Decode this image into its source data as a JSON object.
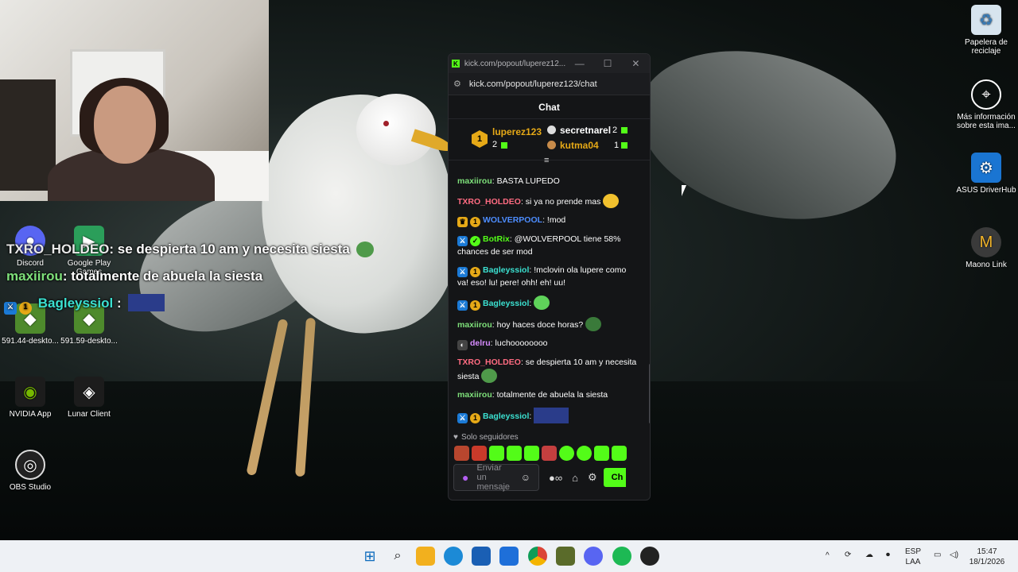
{
  "overlay": {
    "line1_user": "TXRO_HOLDEO",
    "line1_text": ": se despierta 10 am y necesita siesta",
    "line2_user": "maxiirou",
    "line2_text": ": totalmente de abuela la siesta",
    "line3_user": "Bagleyssiol",
    "line3_sep": ":"
  },
  "desktop_icons": [
    {
      "label": "Discord",
      "icon": "discord-icon"
    },
    {
      "label": "Google Play Games",
      "icon": "google-play-icon"
    },
    {
      "label": "591.44-deskto...",
      "icon": "nvidia-installer-icon"
    },
    {
      "label": "591.59-deskto...",
      "icon": "nvidia-installer-icon"
    },
    {
      "label": "NVIDIA App",
      "icon": "nvidia-icon"
    },
    {
      "label": "Lunar Client",
      "icon": "lunar-client-icon"
    },
    {
      "label": "OBS Studio",
      "icon": "obs-icon"
    },
    {
      "label": "Papelera de reciclaje",
      "icon": "recycle-bin-icon"
    },
    {
      "label": "Más información sobre esta ima...",
      "icon": "info-icon"
    },
    {
      "label": "ASUS DriverHub",
      "icon": "asus-icon"
    },
    {
      "label": "Maono Link",
      "icon": "maono-icon"
    }
  ],
  "popup": {
    "tab_title": "kick.com/popout/luperez12...",
    "url": "kick.com/popout/luperez123/chat",
    "chat_header": "Chat",
    "leaderboard": {
      "top_name": "luperez123",
      "top_rank": "1",
      "top_count": "2",
      "second_name": "secretnarel",
      "second_count": "2",
      "third_name": "kutma04",
      "third_count": "1"
    },
    "messages": [
      {
        "user": "maxiirou",
        "color": "#7ee07a",
        "text": "BASTA LUPEDO",
        "badges": []
      },
      {
        "user": "TXRO_HOLDEO",
        "color": "#ff6b81",
        "text": "si ya no prende mas",
        "badges": [],
        "emote": "#f2c12e"
      },
      {
        "user": "WOLVERPOOL",
        "color": "#4d8dff",
        "text": "!mod",
        "badges": [
          "crown",
          "sub"
        ]
      },
      {
        "user": "BotRix",
        "color": "#53fc18",
        "text": "@WOLVERPOOL tiene 58% chances de ser mod",
        "badges": [
          "mod",
          "verified"
        ]
      },
      {
        "user": "Bagleyssiol",
        "color": "#3be0d0",
        "text": "!mclovin ola lupere como va! eso! lu! pere! ohh! eh! uu!",
        "badges": [
          "mod",
          "sub"
        ]
      },
      {
        "user": "Bagleyssiol",
        "color": "#3be0d0",
        "text": "",
        "badges": [
          "mod",
          "sub"
        ],
        "emote": "#5fd35a"
      },
      {
        "user": "maxiirou",
        "color": "#7ee07a",
        "text": "hoy haces doce horas?",
        "badges": [],
        "emote": "#3a7a3a"
      },
      {
        "user": "delru",
        "color": "#d68bff",
        "text": "luchoooooooo",
        "badges": [
          "glasses"
        ]
      },
      {
        "user": "TXRO_HOLDEO",
        "color": "#ff6b81",
        "text": "se despierta 10 am y necesita siesta",
        "badges": [],
        "emote": "#4f9a4a"
      },
      {
        "user": "maxiirou",
        "color": "#7ee07a",
        "text": "totalmente de abuela la siesta",
        "badges": []
      },
      {
        "user": "Bagleyssiol",
        "color": "#3be0d0",
        "text": "",
        "badges": [
          "mod",
          "sub"
        ],
        "emote": "#e6c93a"
      }
    ],
    "followers_only": "Solo seguidores",
    "input_placeholder": "Enviar un mensaje",
    "send_label": "Ch"
  },
  "taskbar": {
    "lang_top": "ESP",
    "lang_bottom": "LAA",
    "time": "15:47",
    "date": "18/1/2026",
    "apps": [
      "windows-start-icon",
      "search-icon",
      "file-explorer-icon",
      "edge-icon",
      "store-icon",
      "outlook-icon",
      "chrome-icon",
      "game-icon",
      "discord-icon",
      "spotify-icon",
      "obs-icon"
    ]
  },
  "colors": {
    "kick_green": "#53fc18",
    "panel_bg": "#141517"
  }
}
